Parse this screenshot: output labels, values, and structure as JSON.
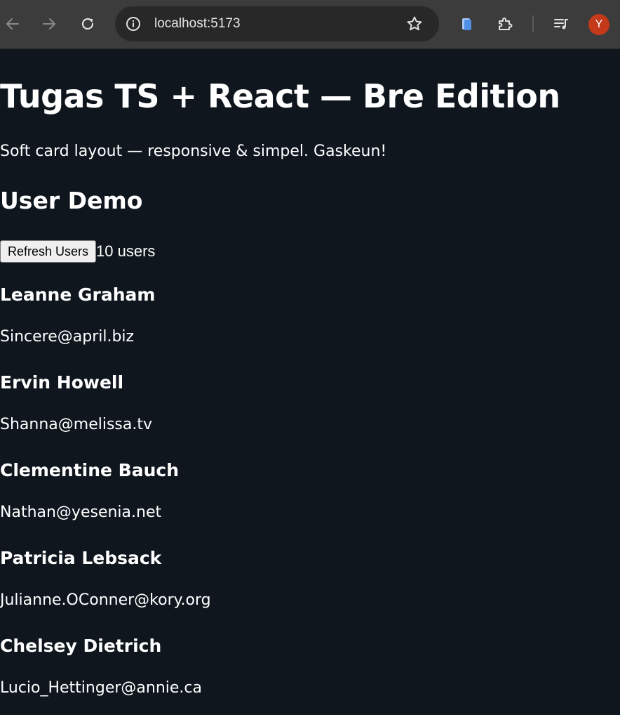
{
  "browser": {
    "url": "localhost:5173",
    "avatar_letter": "Y",
    "icons": [
      "back-icon",
      "forward-icon",
      "reload-icon",
      "site-info-icon",
      "bookmark-star-icon",
      "files-extension-icon",
      "extensions-puzzle-icon",
      "media-queue-icon"
    ]
  },
  "page": {
    "title": "Tugas TS + React — Bre Edition",
    "subtitle": "Soft card layout — responsive & simpel. Gaskeun!",
    "section_title": "User Demo",
    "refresh_label": "Refresh Users",
    "user_count": "10 users"
  },
  "users": [
    {
      "name": "Leanne Graham",
      "email": "Sincere@april.biz"
    },
    {
      "name": "Ervin Howell",
      "email": "Shanna@melissa.tv"
    },
    {
      "name": "Clementine Bauch",
      "email": "Nathan@yesenia.net"
    },
    {
      "name": "Patricia Lebsack",
      "email": "Julianne.OConner@kory.org"
    },
    {
      "name": "Chelsey Dietrich",
      "email": "Lucio_Hettinger@annie.ca"
    }
  ],
  "colors": {
    "page_background": "#0f161e",
    "toolbar_background": "#3c3c3c",
    "omnibox_background": "#282828",
    "avatar_background": "#c5391b",
    "text": "#ffffff"
  }
}
